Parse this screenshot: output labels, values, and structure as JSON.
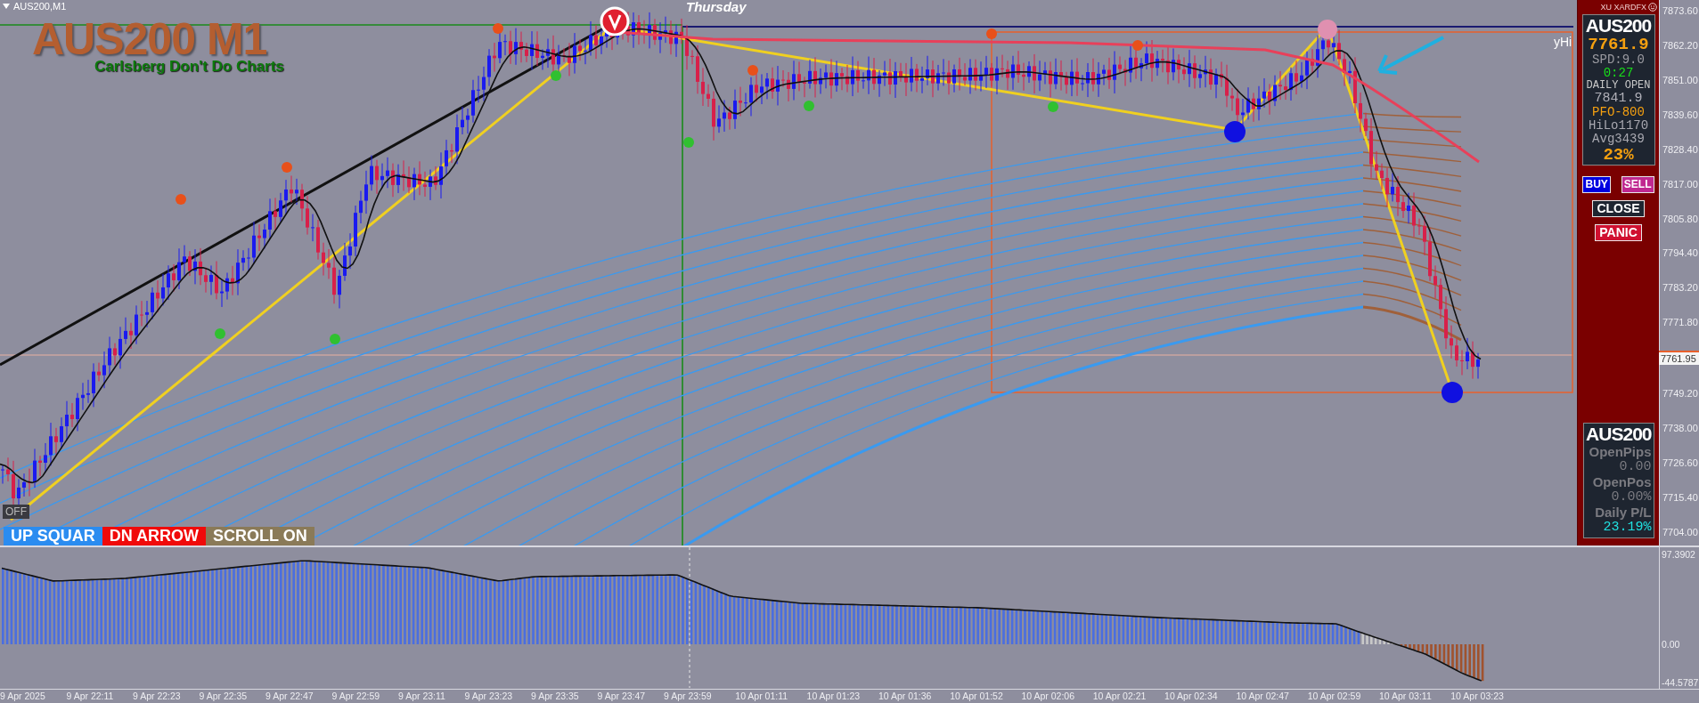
{
  "chart_header": {
    "symbol": "AUS200,M1"
  },
  "title_overlay": {
    "title": "AUS200 M1",
    "subtitle": "Carlsberg Don't Do Charts"
  },
  "day_label": "Thursday",
  "line_label": "yHi",
  "broker": "XU XARDFX",
  "panel": {
    "symbol": "AUS200",
    "price": "7761.9",
    "spread": "SPD:9.0",
    "timer": "0:27",
    "daily_open_label": "DAILY OPEN",
    "daily_open": "7841.9",
    "pfo": "PFO-800",
    "hilo": "HiLo1170",
    "avg": "Avg3439",
    "percent": "23%"
  },
  "trade_buttons": [
    {
      "label": "BUY",
      "kind": "buy"
    },
    {
      "label": "SELL",
      "kind": "sell"
    },
    {
      "label": "CLOSE",
      "kind": "close"
    },
    {
      "label": "PANIC",
      "kind": "panic"
    }
  ],
  "summary": {
    "symbol": "AUS200",
    "items": [
      {
        "label": "OpenPips",
        "value": "0.00",
        "kind": "neutral"
      },
      {
        "label": "OpenPos",
        "value": "0.00%",
        "kind": "neutral"
      },
      {
        "label": "Daily P/L",
        "value": "23.19%",
        "kind": "positive"
      }
    ]
  },
  "off_toggle": "OFF",
  "mode_buttons": [
    {
      "label": "UP SQUAR",
      "color": "#2b8cf0"
    },
    {
      "label": "DN ARROW",
      "color": "#f00a0a"
    },
    {
      "label": "SCROLL ON",
      "color": "#8a7a58"
    }
  ],
  "price_axis": [
    {
      "label": "7873.60",
      "current": false
    },
    {
      "label": "7862.20",
      "current": false
    },
    {
      "label": "7851.00",
      "current": false
    },
    {
      "label": "7839.60",
      "current": false
    },
    {
      "label": "7828.40",
      "current": false
    },
    {
      "label": "7817.00",
      "current": false
    },
    {
      "label": "7805.80",
      "current": false
    },
    {
      "label": "7794.40",
      "current": false
    },
    {
      "label": "7783.20",
      "current": false
    },
    {
      "label": "7771.80",
      "current": false
    },
    {
      "label": "7761.95",
      "current": true
    },
    {
      "label": "7749.20",
      "current": false
    },
    {
      "label": "7738.00",
      "current": false
    },
    {
      "label": "7726.60",
      "current": false
    },
    {
      "label": "7715.40",
      "current": false
    },
    {
      "label": "7704.00",
      "current": false
    }
  ],
  "oscillator_axis": [
    "97.3902",
    "0.00",
    "-44.5787"
  ],
  "time_axis": [
    "9 Apr 2025",
    "9 Apr 22:11",
    "9 Apr 22:23",
    "9 Apr 22:35",
    "9 Apr 22:47",
    "9 Apr 22:59",
    "9 Apr 23:11",
    "9 Apr 23:23",
    "9 Apr 23:35",
    "9 Apr 23:47",
    "9 Apr 23:59",
    "10 Apr 01:11",
    "10 Apr 01:23",
    "10 Apr 01:36",
    "10 Apr 01:52",
    "10 Apr 02:06",
    "10 Apr 02:21",
    "10 Apr 02:34",
    "10 Apr 02:47",
    "10 Apr 02:59",
    "10 Apr 03:11",
    "10 Apr 03:23"
  ]
}
